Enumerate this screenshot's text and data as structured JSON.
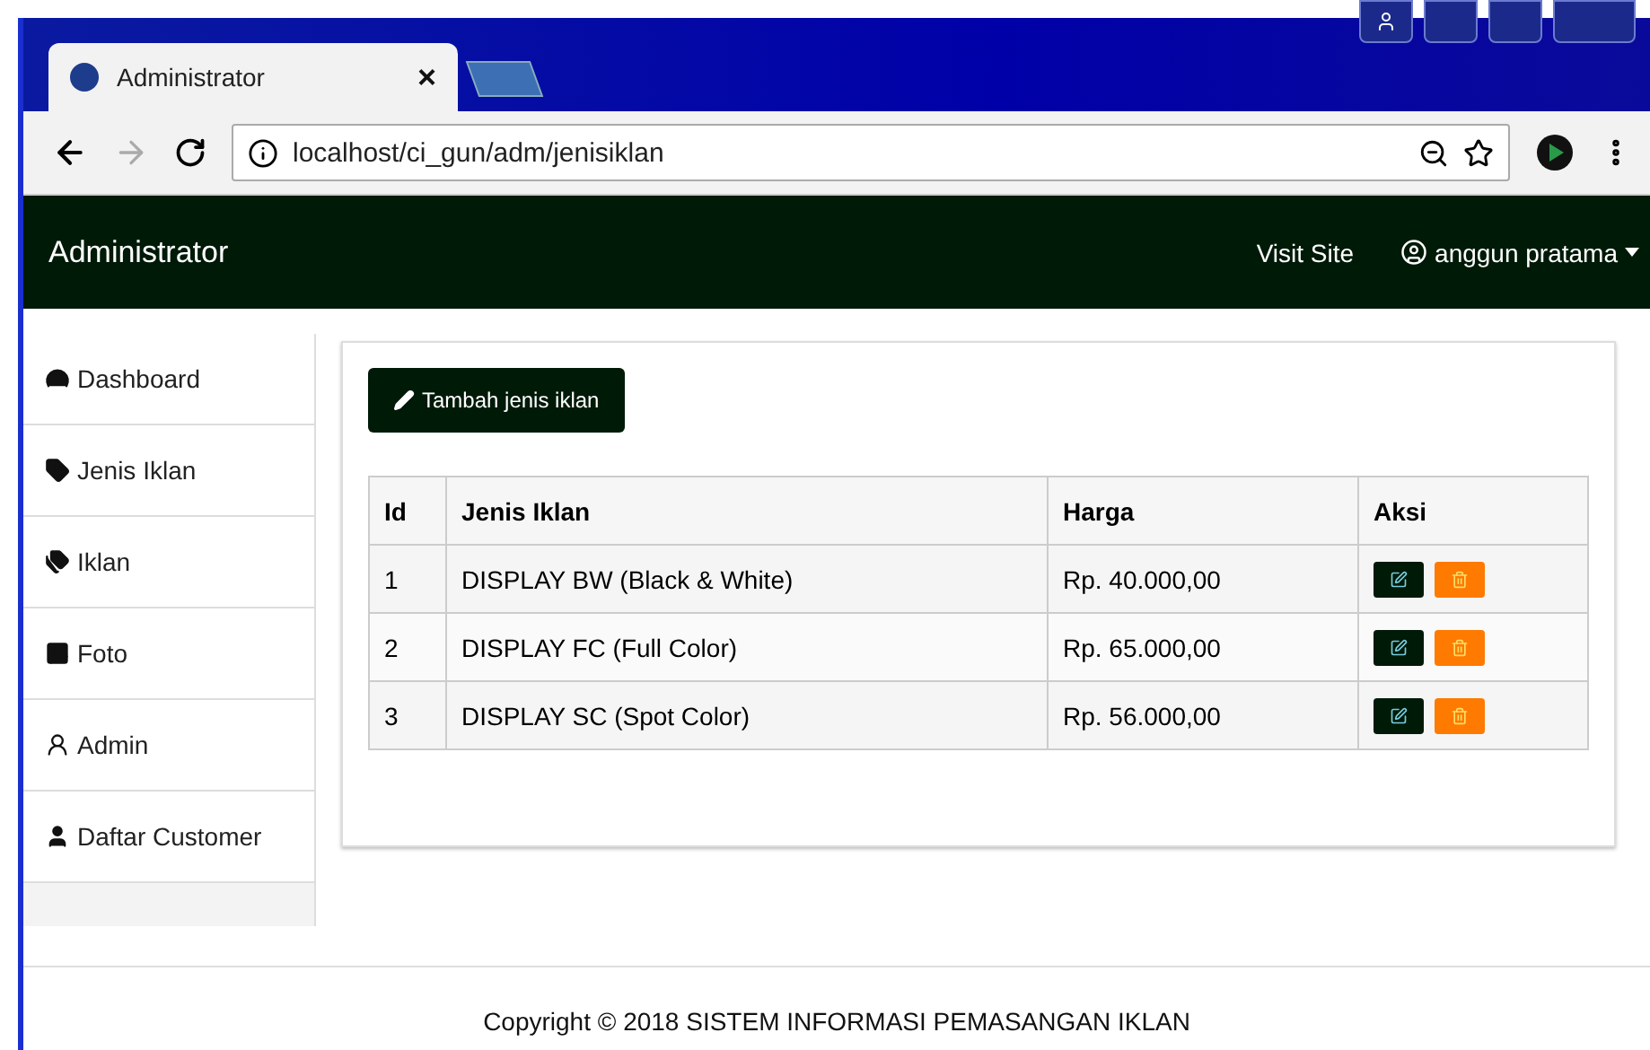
{
  "browser": {
    "tab_title": "Administrator",
    "tab_close": "×",
    "url": "localhost/ci_gun/adm/jenisiklan"
  },
  "navbar": {
    "brand": "Administrator",
    "links": [
      {
        "label": "Visit Site",
        "kind": "link"
      },
      {
        "label": "anggun pratama",
        "kind": "user"
      }
    ]
  },
  "sidebar": {
    "items": [
      {
        "label": "Dashboard"
      },
      {
        "label": "Jenis Iklan"
      },
      {
        "label": "Iklan"
      },
      {
        "label": "Foto"
      },
      {
        "label": "Admin"
      },
      {
        "label": "Daftar Customer"
      }
    ]
  },
  "add_button": "Tambah jenis iklan",
  "table": {
    "columns": [
      "Id",
      "Jenis Iklan",
      "Harga",
      "Aksi"
    ],
    "rows": [
      [
        "1",
        "DISPLAY BW (Black & White)",
        "Rp. 40.000,00"
      ],
      [
        "2",
        "DISPLAY FC (Full Color)",
        "Rp. 65.000,00"
      ],
      [
        "3",
        "DISPLAY SC (Spot Color)",
        "Rp. 56.000,00"
      ]
    ]
  },
  "footer": "Copyright © 2018 SISTEM INFORMASI PEMASANGAN IKLAN"
}
